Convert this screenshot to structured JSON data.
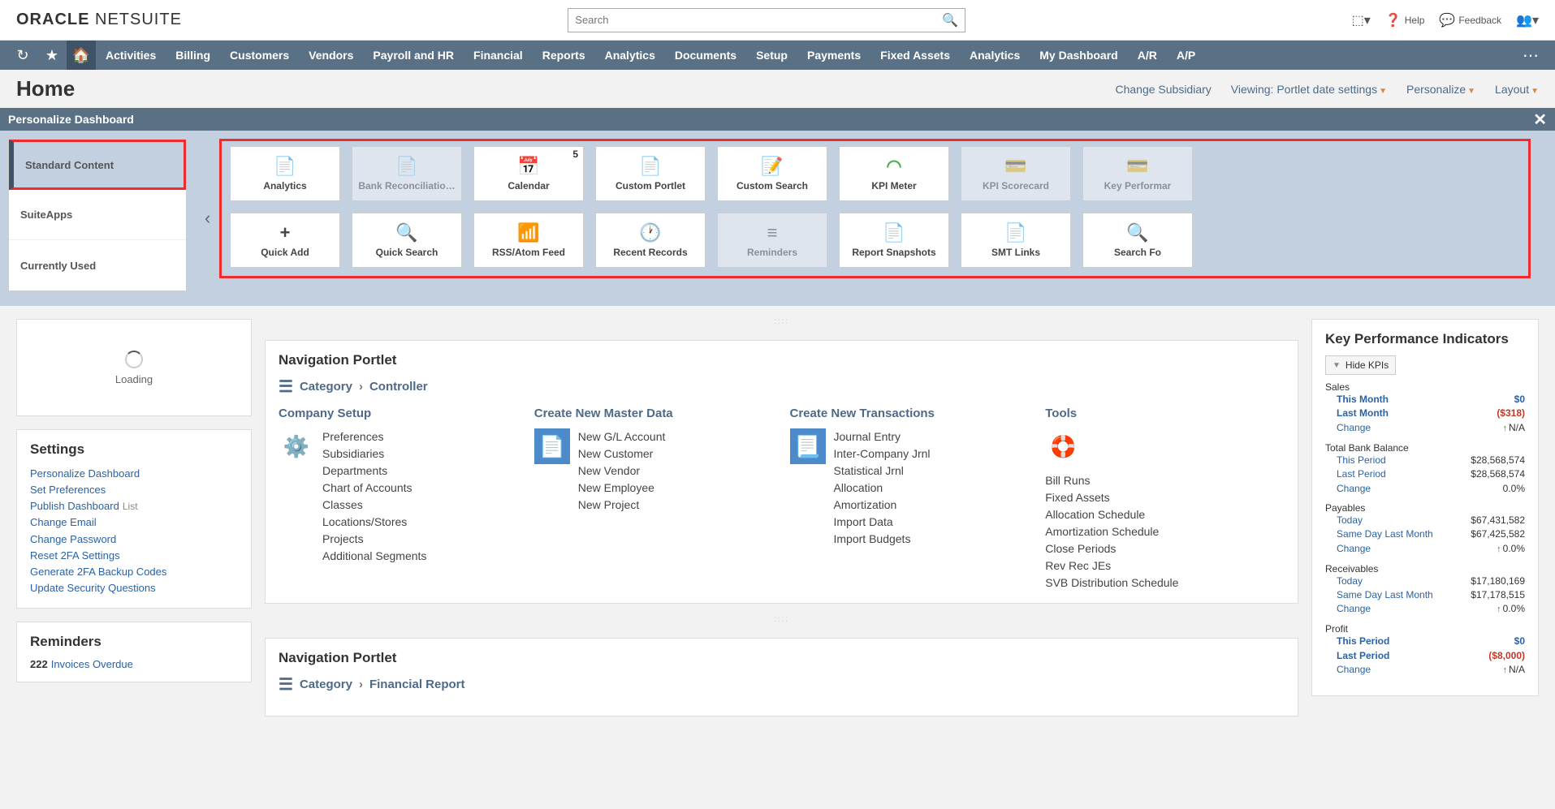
{
  "topbar": {
    "logo_a": "ORACLE",
    "logo_b": "NETSUITE",
    "search_placeholder": "Search",
    "help": "Help",
    "feedback": "Feedback"
  },
  "nav": [
    "Activities",
    "Billing",
    "Customers",
    "Vendors",
    "Payroll and HR",
    "Financial",
    "Reports",
    "Analytics",
    "Documents",
    "Setup",
    "Payments",
    "Fixed Assets",
    "Analytics",
    "My Dashboard",
    "A/R",
    "A/P"
  ],
  "subheader": {
    "title": "Home",
    "change_sub": "Change Subsidiary",
    "viewing": "Viewing: Portlet date settings",
    "personalize": "Personalize",
    "layout": "Layout"
  },
  "personalize": {
    "title": "Personalize Dashboard",
    "tabs": [
      "Standard Content",
      "SuiteApps",
      "Currently Used"
    ],
    "row1": [
      {
        "label": "Analytics",
        "icon": "📄",
        "color": "#2d5fa5"
      },
      {
        "label": "Bank Reconciliatio…",
        "icon": "📄",
        "disabled": true
      },
      {
        "label": "Calendar",
        "icon": "📅",
        "badge": "5"
      },
      {
        "label": "Custom Portlet",
        "icon": "📄"
      },
      {
        "label": "Custom Search",
        "icon": "📝"
      },
      {
        "label": "KPI Meter",
        "icon": "◠",
        "color": "#4caf50"
      },
      {
        "label": "KPI Scorecard",
        "icon": "💳",
        "disabled": true
      },
      {
        "label": "Key Performar",
        "icon": "💳",
        "disabled": true
      }
    ],
    "row2": [
      {
        "label": "Quick Add",
        "icon": "+"
      },
      {
        "label": "Quick Search",
        "icon": "🔍"
      },
      {
        "label": "RSS/Atom Feed",
        "icon": "📶",
        "color": "#e67e22"
      },
      {
        "label": "Recent Records",
        "icon": "🕐",
        "color": "#2d5fa5"
      },
      {
        "label": "Reminders",
        "icon": "≡",
        "disabled": true
      },
      {
        "label": "Report Snapshots",
        "icon": "📄",
        "color": "#2d5fa5"
      },
      {
        "label": "SMT Links",
        "icon": "📄",
        "color": "#2d5fa5"
      },
      {
        "label": "Search Fo",
        "icon": "🔍"
      }
    ]
  },
  "loading": "Loading",
  "settings": {
    "title": "Settings",
    "links": [
      "Personalize Dashboard",
      "Set Preferences"
    ],
    "publish": "Publish Dashboard",
    "publish_list": "List",
    "links2": [
      "Change Email",
      "Change Password",
      "Reset 2FA Settings",
      "Generate 2FA Backup Codes",
      "Update Security Questions"
    ]
  },
  "reminders": {
    "title": "Reminders",
    "count": "222",
    "label": "Invoices Overdue"
  },
  "navportlet1": {
    "title": "Navigation Portlet",
    "crumb_a": "Category",
    "crumb_b": "Controller",
    "groups": [
      {
        "title": "Company Setup",
        "icon": "⚙️",
        "links": [
          "Preferences",
          "Subsidiaries",
          "Departments",
          "Chart of Accounts",
          "Classes",
          "Locations/Stores",
          "Projects",
          "Additional Segments"
        ]
      },
      {
        "title": "Create New Master Data",
        "icon": "📄",
        "links": [
          "New G/L Account",
          "New Customer",
          "New Vendor",
          "New Employee",
          "New Project"
        ]
      },
      {
        "title": "Create New Transactions",
        "icon": "📃",
        "links": [
          "Journal Entry",
          "Inter-Company Jrnl",
          "Statistical Jrnl",
          "Allocation",
          "Amortization",
          "Import Data",
          "Import Budgets"
        ]
      },
      {
        "title": "Tools",
        "icon": "🛟",
        "links": [
          "Bill Runs",
          "Fixed Assets",
          "Allocation Schedule",
          "Amortization Schedule",
          "Close Periods",
          "Rev Rec JEs",
          "SVB Distribution Schedule"
        ]
      }
    ]
  },
  "navportlet2": {
    "title": "Navigation Portlet",
    "crumb_a": "Category",
    "crumb_b": "Financial Report"
  },
  "kpi": {
    "title": "Key Performance Indicators",
    "hide": "Hide KPIs",
    "blocks": [
      {
        "head": "Sales",
        "rows": [
          {
            "l": "This Month",
            "v": "$0",
            "bold": true
          },
          {
            "l": "Last Month",
            "v": "($318)",
            "bold": true,
            "red": true
          },
          {
            "l": "Change",
            "v": "N/A",
            "arrow": true
          }
        ]
      },
      {
        "head": "Total Bank Balance",
        "rows": [
          {
            "l": "This Period",
            "v": "$28,568,574"
          },
          {
            "l": "Last Period",
            "v": "$28,568,574"
          },
          {
            "l": "Change",
            "v": "0.0%"
          }
        ]
      },
      {
        "head": "Payables",
        "rows": [
          {
            "l": "Today",
            "v": "$67,431,582"
          },
          {
            "l": "Same Day Last Month",
            "v": "$67,425,582"
          },
          {
            "l": "Change",
            "v": "0.0%",
            "arrow": true
          }
        ]
      },
      {
        "head": "Receivables",
        "rows": [
          {
            "l": "Today",
            "v": "$17,180,169"
          },
          {
            "l": "Same Day Last Month",
            "v": "$17,178,515"
          },
          {
            "l": "Change",
            "v": "0.0%",
            "arrow": true
          }
        ]
      },
      {
        "head": "Profit",
        "rows": [
          {
            "l": "This Period",
            "v": "$0",
            "bold": true
          },
          {
            "l": "Last Period",
            "v": "($8,000)",
            "bold": true,
            "red": true
          },
          {
            "l": "Change",
            "v": "N/A",
            "arrow": true
          }
        ]
      }
    ]
  }
}
